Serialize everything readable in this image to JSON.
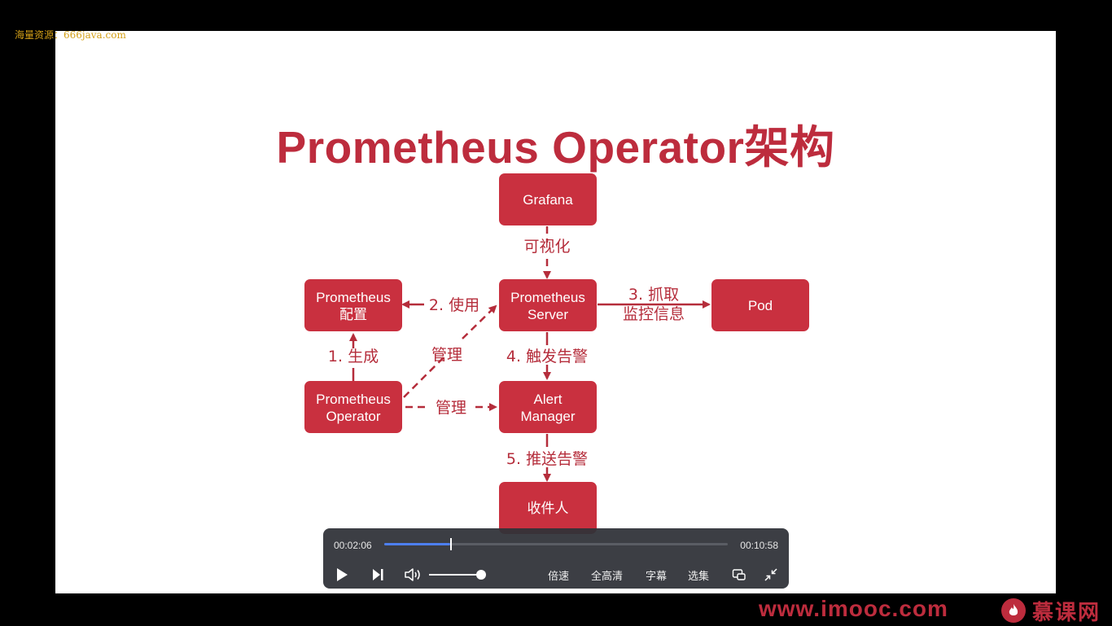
{
  "watermark": "海量资源：666java.com",
  "slide": {
    "title": "Prometheus Operator架构",
    "nodes": {
      "grafana": [
        "Grafana"
      ],
      "prom_config": [
        "Prometheus",
        "配置"
      ],
      "prom_server": [
        "Prometheus",
        "Server"
      ],
      "pod": [
        "Pod"
      ],
      "prom_operator": [
        "Prometheus",
        "Operator"
      ],
      "alertmanager": [
        "Alert",
        "Manager"
      ],
      "receiver": [
        "收件人"
      ]
    },
    "edges": {
      "visualize": "可视化",
      "use": "2. 使用",
      "scrape_1": "3. 抓取",
      "scrape_2": "监控信息",
      "generate": "1. 生成",
      "manage_diag": "管理",
      "manage_horiz": "管理",
      "trigger": "4. 触发告警",
      "push": "5. 推送告警"
    }
  },
  "player": {
    "current_time": "00:02:06",
    "total_time": "00:10:58",
    "progress_fraction": 0.192,
    "volume_fraction": 1.0,
    "speed_label": "倍速",
    "quality_label": "全高清",
    "subtitle_label": "字幕",
    "episodes_label": "选集"
  },
  "footer": {
    "site": "www.imooc.com",
    "brand": "慕课网"
  }
}
